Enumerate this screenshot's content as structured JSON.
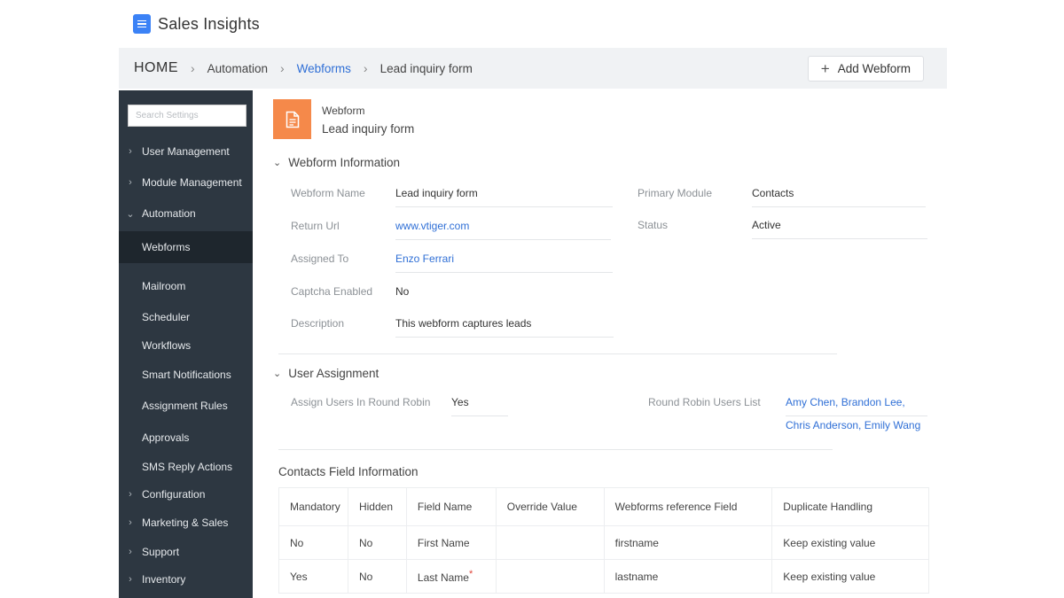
{
  "app": {
    "title": "Sales Insights"
  },
  "breadcrumb": [
    "HOME",
    "Automation",
    "Webforms",
    "Lead inquiry form"
  ],
  "header": {
    "add_button": "Add Webform"
  },
  "sidebar": {
    "search_placeholder": "Search Settings",
    "items": [
      {
        "label": "User Management"
      },
      {
        "label": "Module Management"
      },
      {
        "label": "Automation"
      },
      {
        "label": "Webforms"
      },
      {
        "label": "Mailroom"
      },
      {
        "label": "Scheduler"
      },
      {
        "label": "Workflows"
      },
      {
        "label": "Smart Notifications"
      },
      {
        "label": "Assignment Rules"
      },
      {
        "label": "Approvals"
      },
      {
        "label": "SMS Reply Actions"
      },
      {
        "label": "Configuration"
      },
      {
        "label": "Marketing & Sales"
      },
      {
        "label": "Support"
      },
      {
        "label": "Inventory"
      }
    ]
  },
  "record": {
    "type": "Webform",
    "name": "Lead inquiry form"
  },
  "webform_info": {
    "title": "Webform Information",
    "webform_name_label": "Webform Name",
    "webform_name": "Lead inquiry form",
    "return_url_label": "Return Url",
    "return_url": "www.vtiger.com",
    "assigned_to_label": "Assigned To",
    "assigned_to": "Enzo Ferrari",
    "captcha_label": "Captcha Enabled",
    "captcha": "No",
    "description_label": "Description",
    "description": "This webform captures leads",
    "primary_module_label": "Primary Module",
    "primary_module": "Contacts",
    "status_label": "Status",
    "status": "Active"
  },
  "user_assignment": {
    "title": "User Assignment",
    "round_robin_label": "Assign Users In Round Robin",
    "round_robin": "Yes",
    "users_list_label": "Round Robin Users List",
    "users_line1": "Amy Chen, Brandon Lee,",
    "users_line2": "Chris Anderson, Emily Wang"
  },
  "contacts_fields": {
    "title": "Contacts Field Information",
    "headers": [
      "Mandatory",
      "Hidden",
      "Field Name",
      "Override Value",
      "Webforms reference Field",
      "Duplicate Handling"
    ],
    "rows": [
      [
        "No",
        "No",
        "First Name",
        "",
        "firstname",
        "Keep existing value"
      ],
      [
        "Yes",
        "No",
        "Last Name",
        "",
        "lastname",
        "Keep existing value"
      ]
    ],
    "required_mark": "*"
  }
}
